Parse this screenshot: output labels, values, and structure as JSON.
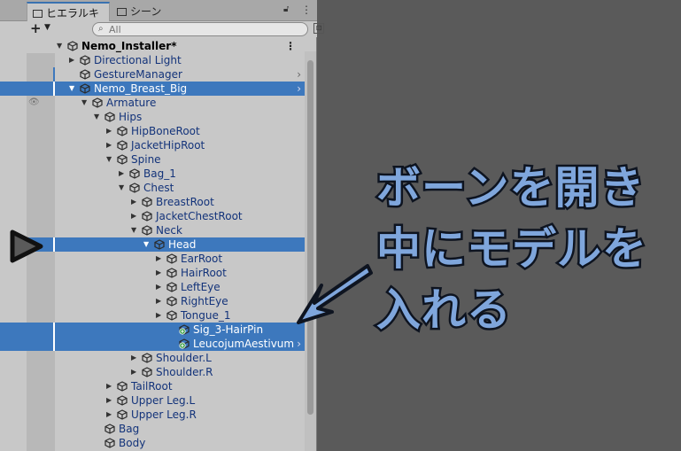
{
  "tabs": [
    {
      "label": "ヒエラルキー"
    },
    {
      "label": "シーン"
    }
  ],
  "toolbar": {
    "add_label": "+",
    "search_placeholder": "All"
  },
  "scene": {
    "name": "Nemo_Installer*"
  },
  "rows": [
    {
      "label": "Directional Light",
      "depth": 0,
      "arrow": "right"
    },
    {
      "label": "GestureManager",
      "depth": 0,
      "arrow": "",
      "chevron": true
    },
    {
      "label": "Nemo_Breast_Big",
      "depth": 0,
      "arrow": "down",
      "selected": true,
      "chevron": true
    },
    {
      "label": "Armature",
      "depth": 1,
      "arrow": "down"
    },
    {
      "label": "Hips",
      "depth": 2,
      "arrow": "down"
    },
    {
      "label": "HipBoneRoot",
      "depth": 3,
      "arrow": "right"
    },
    {
      "label": "JacketHipRoot",
      "depth": 3,
      "arrow": "right"
    },
    {
      "label": "Spine",
      "depth": 3,
      "arrow": "down"
    },
    {
      "label": "Bag_1",
      "depth": 4,
      "arrow": "right"
    },
    {
      "label": "Chest",
      "depth": 4,
      "arrow": "down"
    },
    {
      "label": "BreastRoot",
      "depth": 5,
      "arrow": "right"
    },
    {
      "label": "JacketChestRoot",
      "depth": 5,
      "arrow": "right"
    },
    {
      "label": "Neck",
      "depth": 5,
      "arrow": "down"
    },
    {
      "label": "Head",
      "depth": 6,
      "arrow": "down",
      "selected": true
    },
    {
      "label": "EarRoot",
      "depth": 7,
      "arrow": "right"
    },
    {
      "label": "HairRoot",
      "depth": 7,
      "arrow": "right"
    },
    {
      "label": "LeftEye",
      "depth": 7,
      "arrow": "right"
    },
    {
      "label": "RightEye",
      "depth": 7,
      "arrow": "right"
    },
    {
      "label": "Tongue_1",
      "depth": 7,
      "arrow": "right"
    },
    {
      "label": "Sig_3-HairPin",
      "depth": 8,
      "arrow": "",
      "selected": true,
      "prefab_add": true
    },
    {
      "label": "LeucojumAestivum",
      "depth": 8,
      "arrow": "",
      "selected": true,
      "prefab_add": true,
      "chevron": true
    },
    {
      "label": "Shoulder.L",
      "depth": 5,
      "arrow": "right"
    },
    {
      "label": "Shoulder.R",
      "depth": 5,
      "arrow": "right"
    },
    {
      "label": "TailRoot",
      "depth": 3,
      "arrow": "right"
    },
    {
      "label": "Upper Leg.L",
      "depth": 3,
      "arrow": "right"
    },
    {
      "label": "Upper Leg.R",
      "depth": 3,
      "arrow": "right"
    },
    {
      "label": "Bag",
      "depth": 2,
      "arrow": ""
    },
    {
      "label": "Body",
      "depth": 2,
      "arrow": ""
    }
  ],
  "overlay": {
    "line1": "ボーンを開き",
    "line2": "中にモデルを",
    "line3": "入れる"
  },
  "colors": {
    "selection": "#3d78bd",
    "annotation_fill": "#7fa6dc",
    "annotation_stroke": "#0e1420"
  }
}
